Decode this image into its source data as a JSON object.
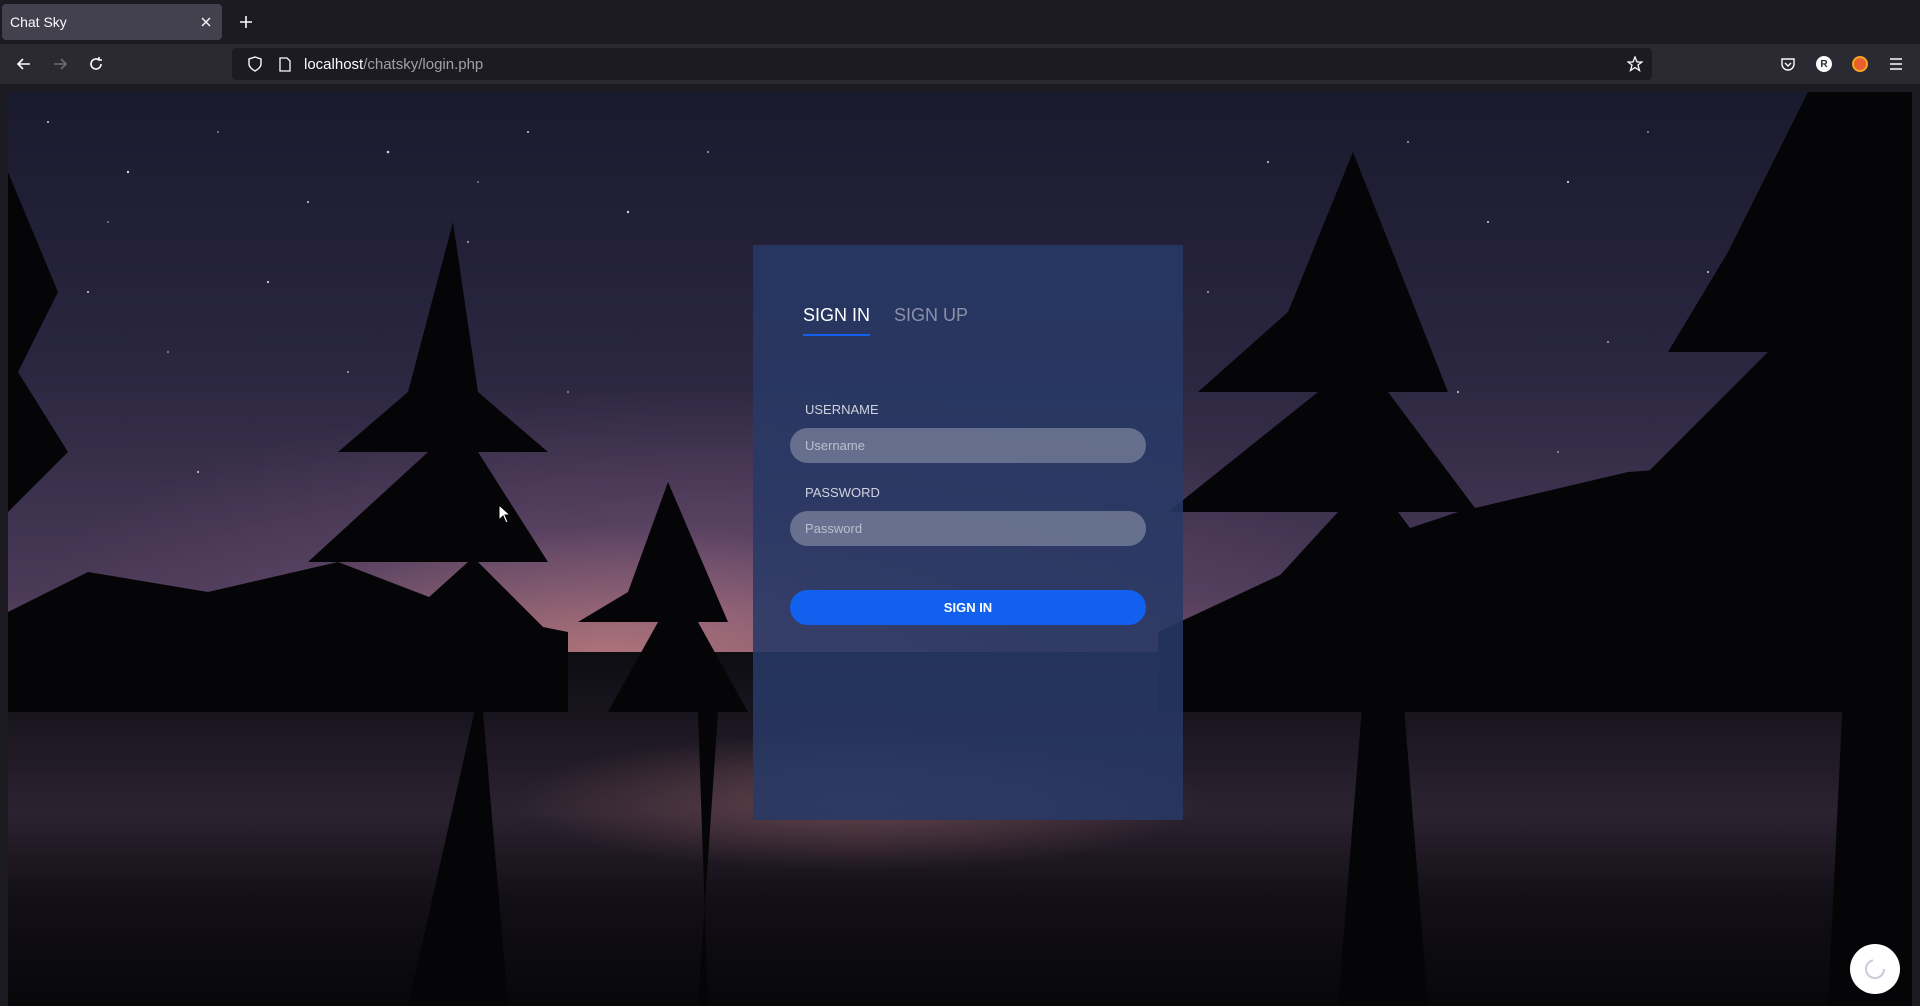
{
  "browser": {
    "tab": {
      "title": "Chat Sky"
    },
    "url": {
      "host": "localhost",
      "path": "/chatsky/login.php"
    },
    "icons": [
      "back-icon",
      "forward-icon",
      "reload-icon",
      "shield-icon",
      "page-icon",
      "star-icon",
      "pocket-icon",
      "account-icon",
      "extension-icon",
      "menu-icon"
    ],
    "account_initial": "R"
  },
  "login": {
    "tabs": [
      {
        "label": "SIGN IN",
        "active": true
      },
      {
        "label": "SIGN UP",
        "active": false
      }
    ],
    "username": {
      "label": "USERNAME",
      "placeholder": "Username",
      "value": ""
    },
    "password": {
      "label": "PASSWORD",
      "placeholder": "Password",
      "value": ""
    },
    "submit_label": "SIGN IN"
  },
  "colors": {
    "accent": "#1161ee",
    "card": "#283965"
  }
}
